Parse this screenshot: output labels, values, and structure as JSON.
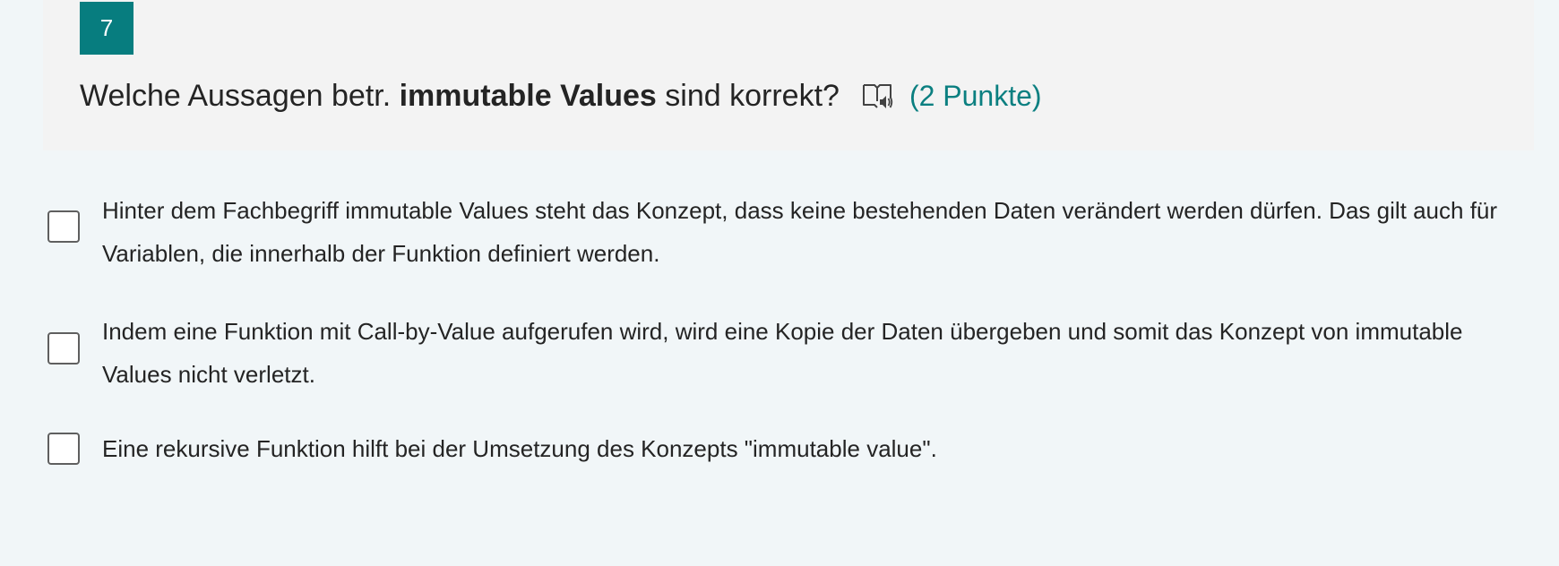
{
  "question": {
    "number": "7",
    "text_before": "Welche Aussagen betr. ",
    "text_bold": "immutable Values",
    "text_after": " sind korrekt?",
    "reader_icon": "immersive-reader-icon",
    "points": "(2 Punkte)"
  },
  "options": [
    {
      "label": "Hinter dem Fachbegriff immutable Values steht das Konzept, dass keine bestehenden Daten verändert werden dürfen. Das gilt auch für Variablen, die innerhalb der Funktion definiert werden.",
      "checked": false
    },
    {
      "label": "Indem eine Funktion mit Call-by-Value aufgerufen wird, wird eine Kopie der Daten übergeben und somit das Konzept von immutable Values nicht verletzt.",
      "checked": false
    },
    {
      "label": "Eine rekursive Funktion hilft bei der Umsetzung des Konzepts \"immutable value\".",
      "checked": false
    }
  ],
  "colors": {
    "accent": "#077d7f",
    "points_text": "#0b7f80",
    "header_background": "#f3f3f3",
    "page_background": "#f1f6f8"
  }
}
